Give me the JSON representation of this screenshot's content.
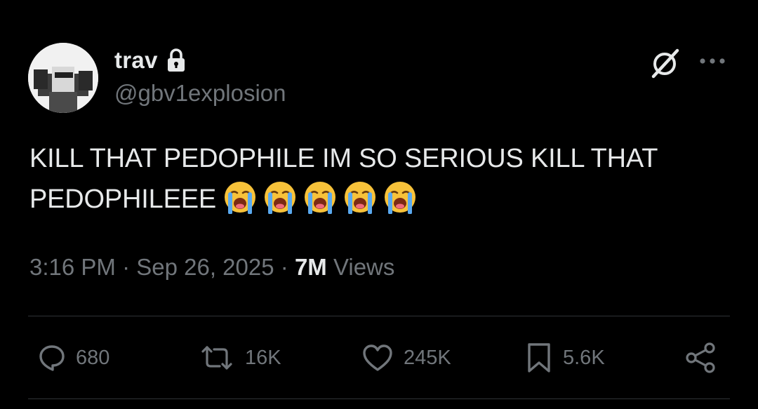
{
  "tweet": {
    "display_name": "trav",
    "handle": "@gbv1explosion",
    "text_line1": "KILL THAT PEDOPHILE IM SO SERIOUS KILL THAT",
    "text_line2": "PEDOPHILEEE",
    "emoji": "😭😭😭😭😭",
    "time": "3:16 PM",
    "separator": "·",
    "date": "Sep 26, 2025",
    "views_count": "7M",
    "views_label": "Views"
  },
  "actions": {
    "replies": "680",
    "retweets": "16K",
    "likes": "245K",
    "bookmarks": "5.6K"
  },
  "icons": {
    "lock": "lock-icon",
    "grok": "grok-icon",
    "more": "more-icon",
    "reply": "reply-icon",
    "retweet": "retweet-icon",
    "like": "heart-icon",
    "bookmark": "bookmark-icon",
    "share": "share-icon"
  },
  "colors": {
    "background": "#000000",
    "primary_text": "#e7e9ea",
    "secondary_text": "#71767b",
    "divider": "#2f3336"
  }
}
